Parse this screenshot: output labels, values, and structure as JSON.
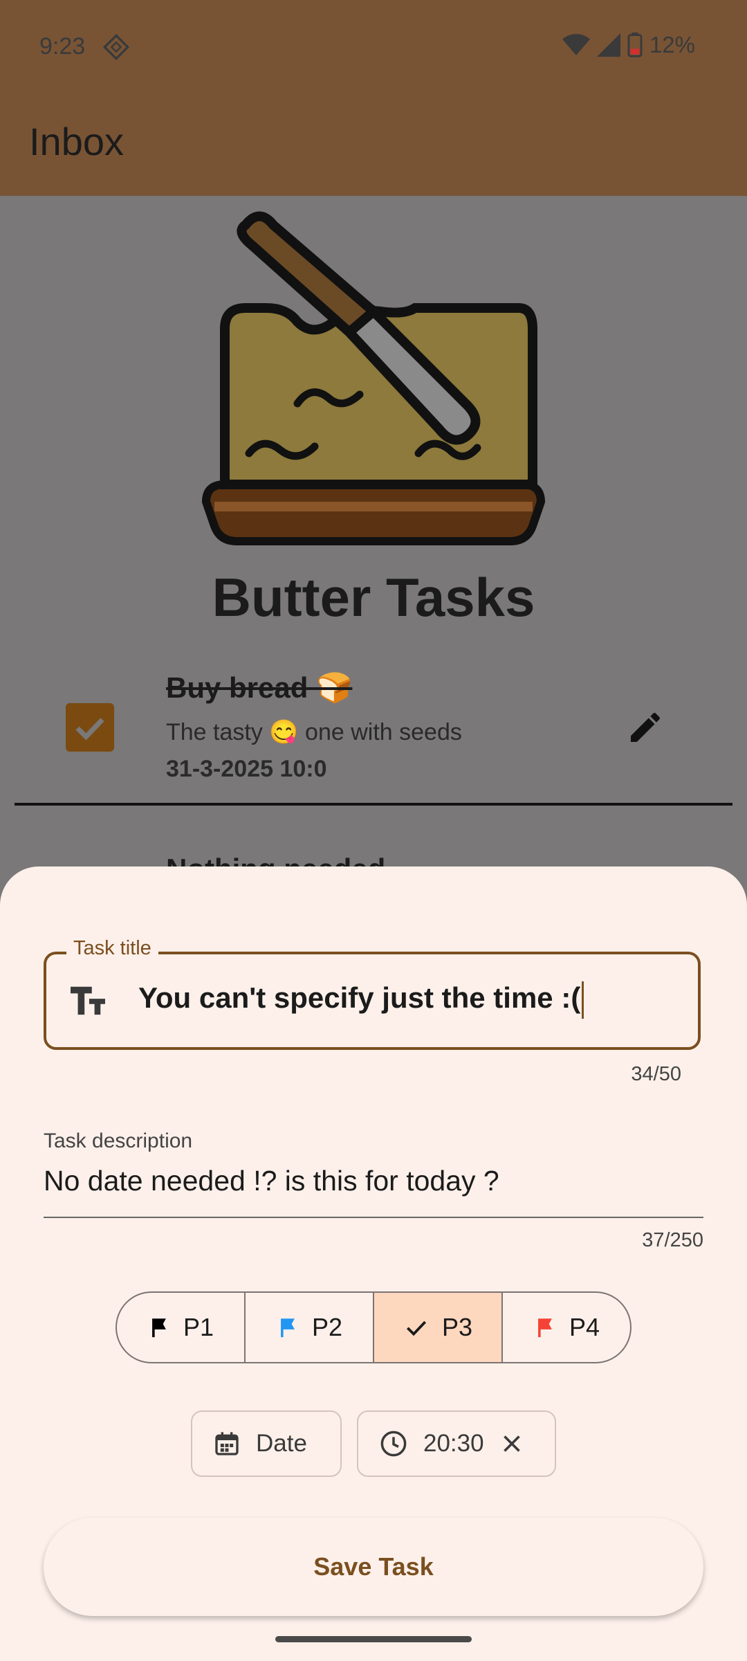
{
  "status_bar": {
    "time": "9:23",
    "battery_percent": "12%",
    "icons": [
      "dnd-icon",
      "wifi-icon",
      "signal-icon",
      "battery-low-icon"
    ]
  },
  "app_bar": {
    "title": "Inbox"
  },
  "brand": {
    "name": "Butter Tasks",
    "logo": "butter-knife-logo"
  },
  "task_list": [
    {
      "title": "Buy bread 🍞",
      "description": "The tasty 😋 one with seeds",
      "due": "31-3-2025 10:0",
      "completed": true
    },
    {
      "title": "Nothing needed"
    }
  ],
  "sheet": {
    "title_field": {
      "label": "Task title",
      "value": "You can't specify just the time :(",
      "counter": "34/50",
      "icon": "text-size-icon"
    },
    "description_field": {
      "label": "Task description",
      "value": "No date needed !? is this for today ?",
      "counter": "37/250"
    },
    "priorities": [
      {
        "label": "P1",
        "icon": "flag-icon",
        "color": "#000000",
        "selected": false
      },
      {
        "label": "P2",
        "icon": "flag-icon",
        "color": "#2196f3",
        "selected": false
      },
      {
        "label": "P3",
        "icon": "check-icon",
        "color": "#1b1b1b",
        "selected": true
      },
      {
        "label": "P4",
        "icon": "flag-icon",
        "color": "#f44336",
        "selected": false
      }
    ],
    "date_chip": {
      "label": "Date",
      "icon": "calendar-icon"
    },
    "time_chip": {
      "label": "20:30",
      "icon": "clock-icon",
      "clear_icon": "close-icon"
    },
    "save_button": "Save Task"
  },
  "colors": {
    "app_bar": "#785435",
    "sheet_bg": "#fdf0ea",
    "accent": "#7a4f1f",
    "selected_chip": "#fed7bf"
  }
}
